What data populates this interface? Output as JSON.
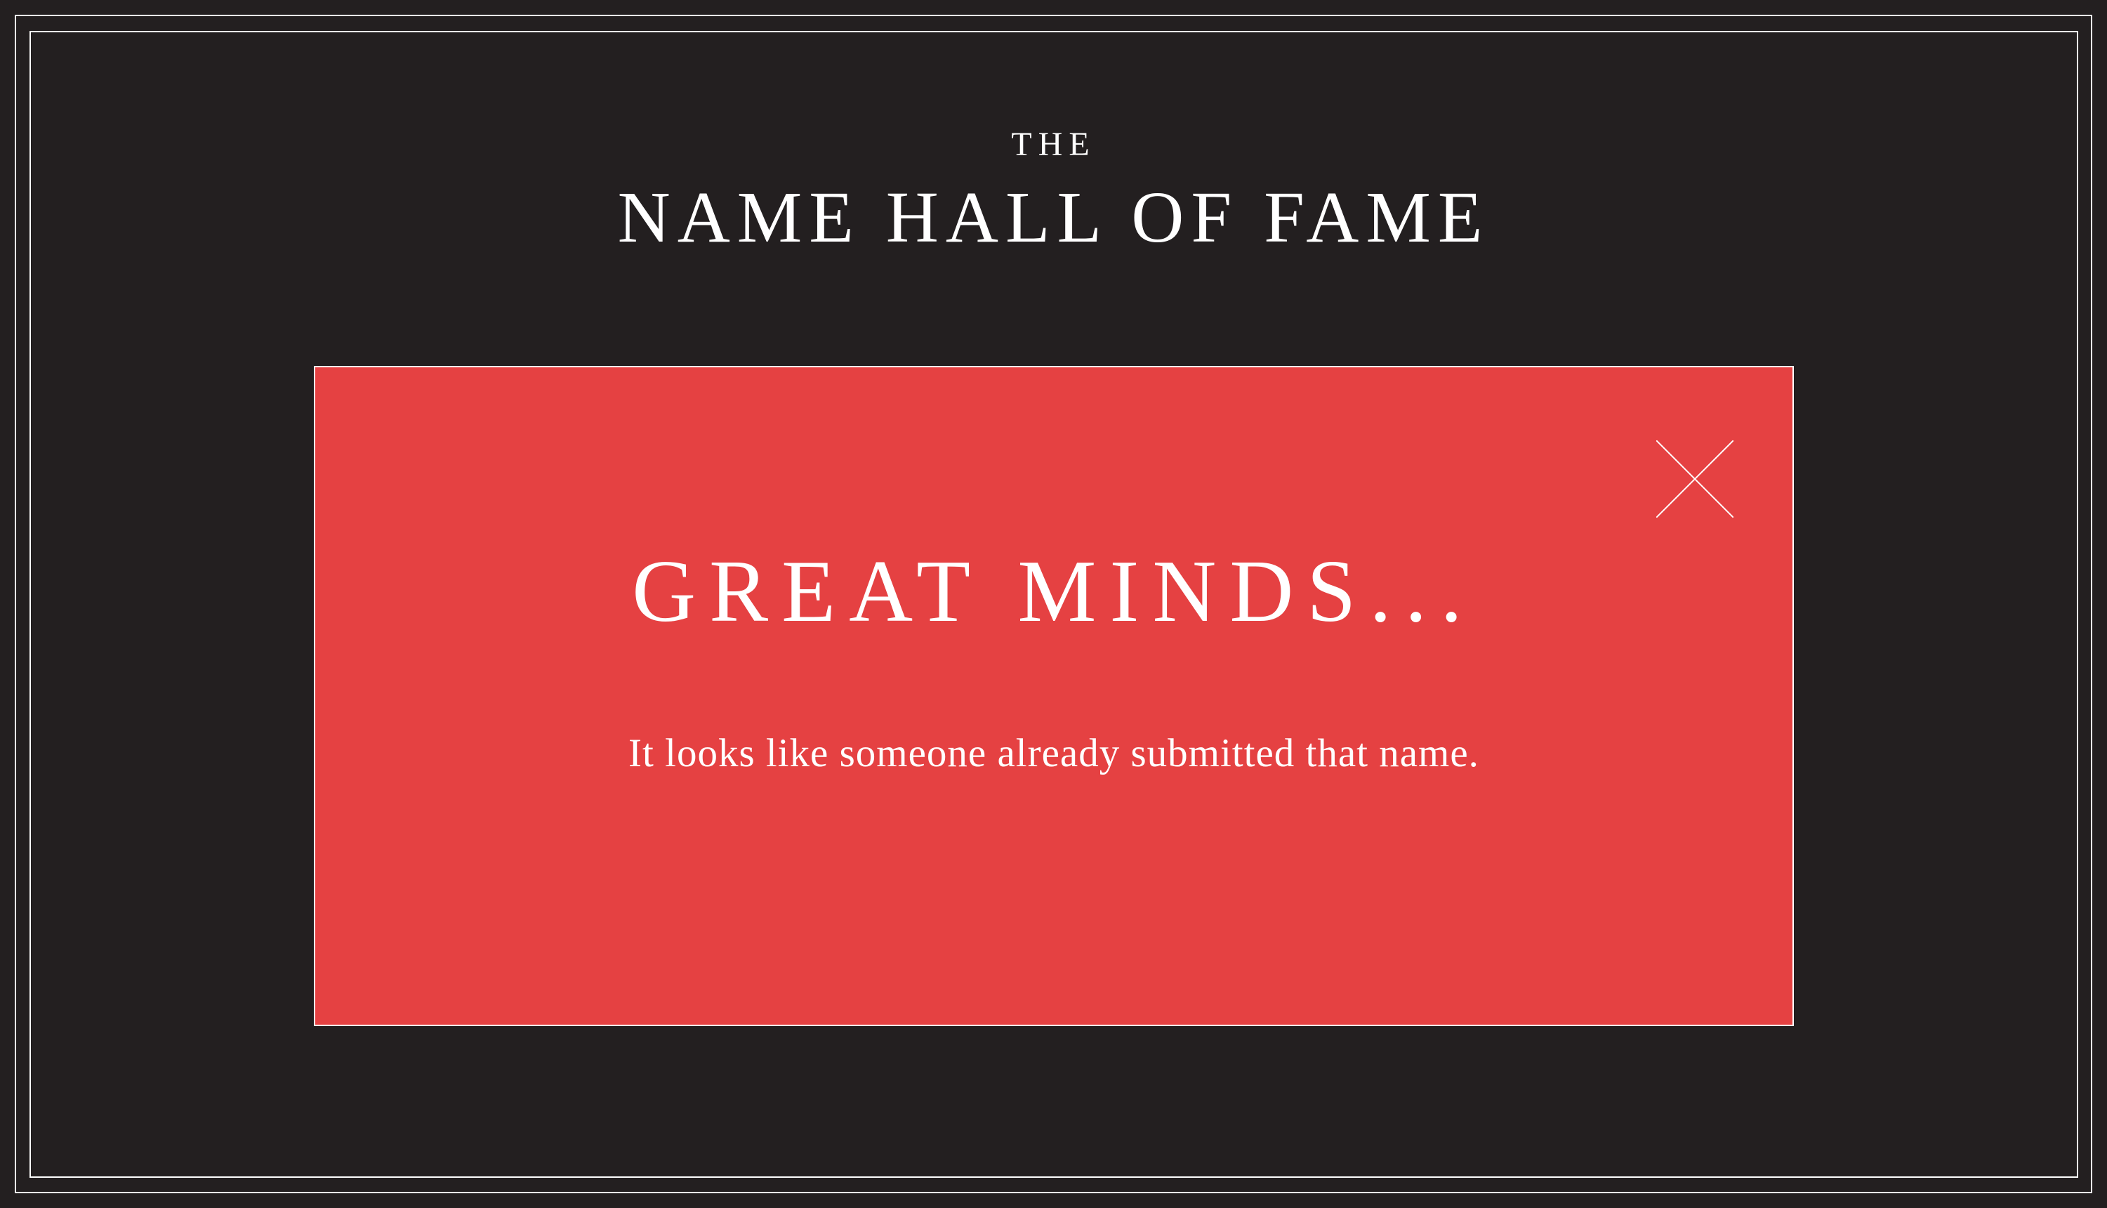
{
  "header": {
    "kicker": "THE",
    "title": "NAME HALL OF FAME"
  },
  "modal": {
    "title": "GREAT MINDS...",
    "message": "It looks like someone already submitted that name.",
    "close_icon": "close-icon"
  },
  "colors": {
    "background": "#231f20",
    "modal_background": "#e54142",
    "text": "#ffffff",
    "border": "#ffffff"
  }
}
